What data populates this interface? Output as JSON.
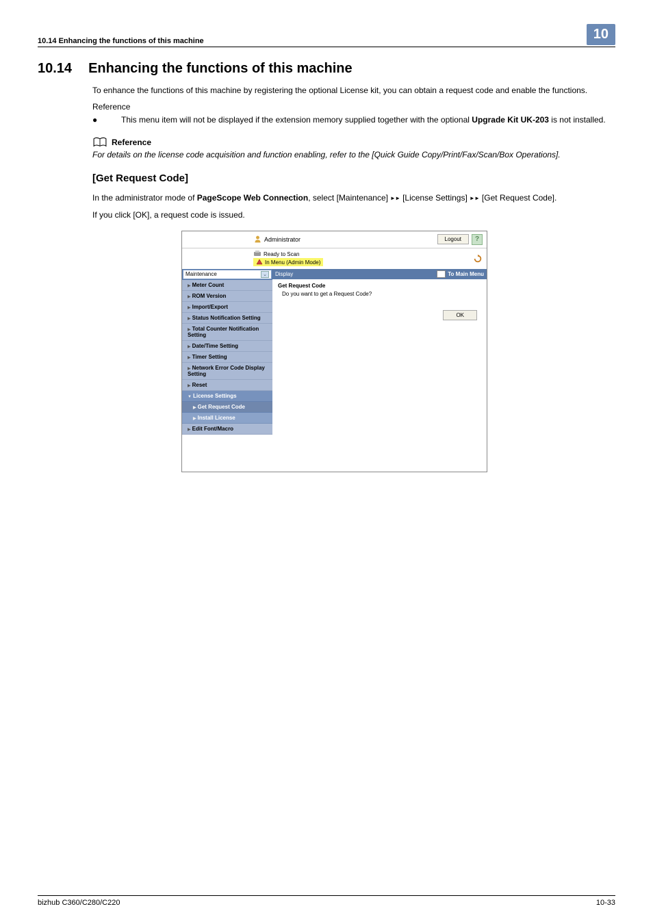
{
  "header": {
    "left": "10.14   Enhancing the functions of this machine",
    "badge": "10"
  },
  "section": {
    "number": "10.14",
    "title": "Enhancing the functions of this machine",
    "intro": "To enhance the functions of this machine by registering the optional License kit, you can obtain a request code and enable the functions.",
    "reference_label": "Reference",
    "bullet_prefix": "This menu item will not be displayed if the extension memory supplied together with the optional ",
    "bullet_bold": "Upgrade Kit UK-203",
    "bullet_suffix": " is not installed."
  },
  "refbox": {
    "label": "Reference",
    "text": "For details on the license code acquisition and function enabling, refer to the [Quick Guide Copy/Print/Fax/Scan/Box Operations]."
  },
  "subsection": {
    "title": "[Get Request Code]",
    "line1_prefix": "In the administrator mode of ",
    "line1_bold": "PageScope Web Connection",
    "line1_mid": ", select [Maintenance] ",
    "arrow": "▸▸",
    "line1_licset": " [License Settings] ",
    "line1_end": " [Get Request Code].",
    "line2": "If you click [OK], a request code is issued."
  },
  "screenshot": {
    "admin_label": "Administrator",
    "logout": "Logout",
    "help": "?",
    "ready": "Ready to Scan",
    "in_menu": "In Menu (Admin Mode)",
    "dropdown": "Maintenance",
    "display_btn": "Display",
    "to_main": "To Main Menu",
    "menu": {
      "meter": "Meter Count",
      "rom": "ROM Version",
      "import": "Import/Export",
      "status_notif": "Status Notification Setting",
      "total_counter": "Total Counter Notification Setting",
      "datetime": "Date/Time Setting",
      "timer": "Timer Setting",
      "neterror": "Network Error Code Display Setting",
      "reset": "Reset",
      "license": "License Settings",
      "get_request": "Get Request Code",
      "install": "Install License",
      "edit_font": "Edit Font/Macro"
    },
    "content": {
      "title": "Get Request Code",
      "msg": "Do you want to get a Request Code?",
      "ok": "OK"
    }
  },
  "footer": {
    "left": "bizhub C360/C280/C220",
    "right": "10-33"
  }
}
